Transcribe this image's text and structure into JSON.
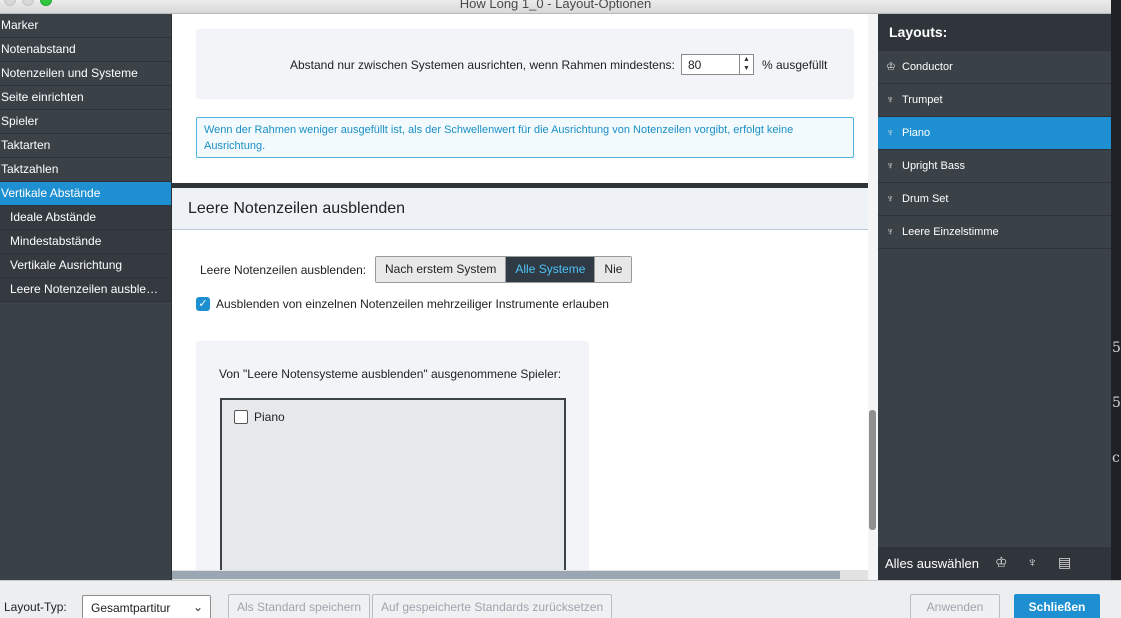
{
  "window": {
    "title": "How Long 1_0 - Layout-Optionen"
  },
  "leftnav": {
    "items": [
      {
        "label": "Marker"
      },
      {
        "label": "Notenabstand"
      },
      {
        "label": "Notenzeilen und Systeme"
      },
      {
        "label": "Seite einrichten"
      },
      {
        "label": "Spieler"
      },
      {
        "label": "Taktarten"
      },
      {
        "label": "Taktzahlen"
      },
      {
        "label": "Vertikale Abstände"
      },
      {
        "label": "Ideale Abstände"
      },
      {
        "label": "Mindestabstände"
      },
      {
        "label": "Vertikale Ausrichtung"
      },
      {
        "label": "Leere Notenzeilen ausble…"
      }
    ]
  },
  "main": {
    "threshold_label": "Abstand nur zwischen Systemen ausrichten, wenn Rahmen mindestens:",
    "threshold_value": "80",
    "threshold_unit": "% ausgefüllt",
    "info_text": "Wenn der Rahmen weniger ausgefüllt ist, als der Schwellenwert für die Ausrichtung von Notenzeilen vorgibt, erfolgt keine Ausrichtung.",
    "section_title": "Leere Notenzeilen ausblenden",
    "hide_label": "Leere Notenzeilen ausblenden:",
    "hide_options": [
      "Nach erstem System",
      "Alle Systeme",
      "Nie"
    ],
    "hide_selected": "Alle Systeme",
    "allow_checkbox_label": "Ausblenden von einzelnen Notenzeilen mehrzeiliger Instrumente erlauben",
    "allow_checked": true,
    "excluded_label": "Von \"Leere Notensysteme ausblenden\" ausgenommene Spieler:",
    "excluded_players": [
      {
        "label": "Piano",
        "checked": false
      }
    ]
  },
  "layouts": {
    "title": "Layouts:",
    "items": [
      {
        "label": "Conductor",
        "icon": "score-icon"
      },
      {
        "label": "Trumpet",
        "icon": "part-icon"
      },
      {
        "label": "Piano",
        "icon": "part-icon"
      },
      {
        "label": "Upright Bass",
        "icon": "part-icon"
      },
      {
        "label": "Drum Set",
        "icon": "part-icon"
      },
      {
        "label": "Leere Einzelstimme",
        "icon": "part-icon"
      }
    ],
    "selected": "Piano",
    "select_all": "Alles auswählen"
  },
  "bottom": {
    "layout_type_label": "Layout-Typ:",
    "layout_type_value": "Gesamtpartitur",
    "save_default": "Als Standard speichern",
    "reset_default": "Auf gespeicherte Standards zurücksetzen",
    "apply": "Anwenden",
    "close": "Schließen"
  },
  "colors": {
    "accent": "#1e90d2",
    "sidebar": "#3a4147",
    "info": "#1a8fc4"
  }
}
